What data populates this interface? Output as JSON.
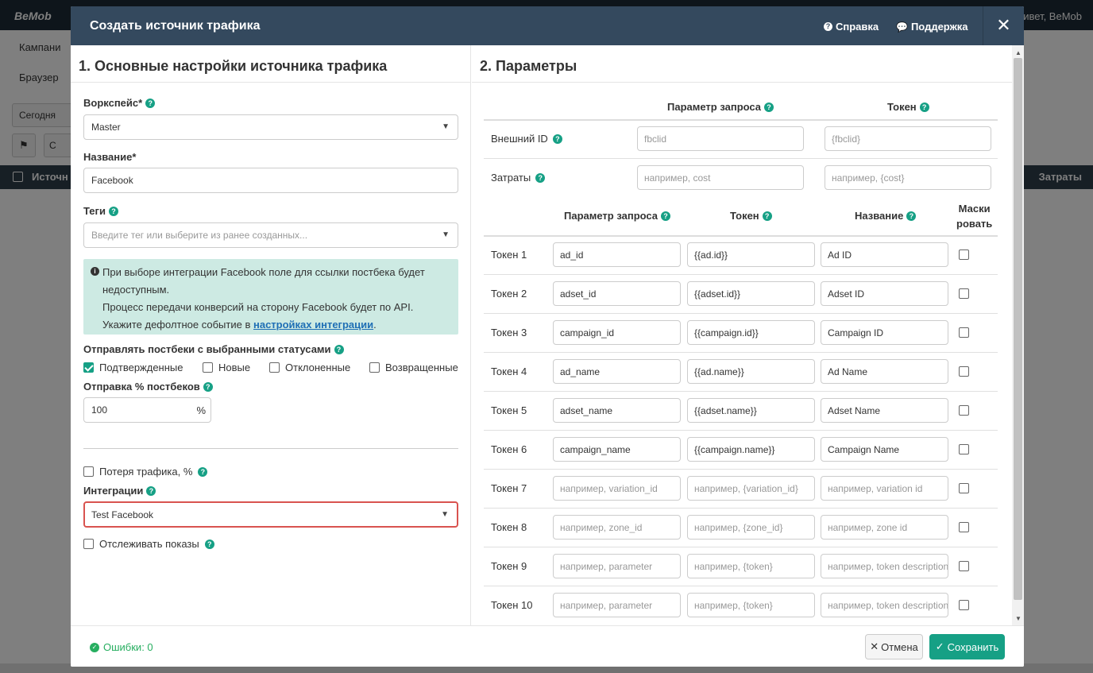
{
  "background": {
    "logo": "BeMob",
    "greeting": "ривет, BeMob",
    "nav_campaigns": "Кампани",
    "nav_browsers": "Браузер",
    "date_button": "Сегодня",
    "small_button": "С",
    "table_col_source": "Источн",
    "table_col_costs": "Затраты"
  },
  "modal": {
    "title": "Создать источник трафика",
    "help_label": "Справка",
    "support_label": "Поддержка",
    "close_label": "✕"
  },
  "left": {
    "title": "1. Основные настройки источника трафика",
    "workspace_label": "Воркспейс*",
    "workspace_value": "Master",
    "name_label": "Название*",
    "name_value": "Facebook",
    "tags_label": "Теги",
    "tags_placeholder": "Введите тег или выберите из ранее созданных...",
    "info_line1": "При выборе интеграции Facebook поле для ссылки постбека будет недоступным.",
    "info_line2": "Процесс передачи конверсий на сторону Facebook будет по API.",
    "info_line3_prefix": "Укажите дефолтное событие в ",
    "info_link": "настройках интеграции",
    "info_line3_suffix": ".",
    "statuses_label": "Отправлять постбеки с выбранными статусами",
    "statuses": [
      {
        "label": "Подтвержденные",
        "checked": true
      },
      {
        "label": "Новые",
        "checked": false
      },
      {
        "label": "Отклоненные",
        "checked": false
      },
      {
        "label": "Возвращенные",
        "checked": false
      }
    ],
    "postback_pct_label": "Отправка % постбеков",
    "postback_pct_value": "100",
    "pct_sign": "%",
    "traffic_loss_label": "Потеря трафика, %",
    "integrations_label": "Интеграции",
    "integrations_value": "Test Facebook",
    "track_impressions_label": "Отслеживать показы"
  },
  "right": {
    "title": "2. Параметры",
    "top_head_param": "Параметр запроса",
    "top_head_token": "Токен",
    "external_id_label": "Внешний ID",
    "external_id_param_placeholder": "fbclid",
    "external_id_token_placeholder": "{fbclid}",
    "costs_label": "Затраты",
    "costs_param_placeholder": "например, cost",
    "costs_token_placeholder": "например, {cost}",
    "head_param": "Параметр запроса",
    "head_token": "Токен",
    "head_name": "Название",
    "head_mask_1": "Маски",
    "head_mask_2": "ровать",
    "tokens": [
      {
        "label": "Токен 1",
        "param": "ad_id",
        "token": "{{ad.id}}",
        "name": "Ad ID",
        "p_ph": "",
        "t_ph": "",
        "n_ph": ""
      },
      {
        "label": "Токен 2",
        "param": "adset_id",
        "token": "{{adset.id}}",
        "name": "Adset ID",
        "p_ph": "",
        "t_ph": "",
        "n_ph": ""
      },
      {
        "label": "Токен 3",
        "param": "campaign_id",
        "token": "{{campaign.id}}",
        "name": "Campaign ID",
        "p_ph": "",
        "t_ph": "",
        "n_ph": ""
      },
      {
        "label": "Токен 4",
        "param": "ad_name",
        "token": "{{ad.name}}",
        "name": "Ad Name",
        "p_ph": "",
        "t_ph": "",
        "n_ph": ""
      },
      {
        "label": "Токен 5",
        "param": "adset_name",
        "token": "{{adset.name}}",
        "name": "Adset Name",
        "p_ph": "",
        "t_ph": "",
        "n_ph": ""
      },
      {
        "label": "Токен 6",
        "param": "campaign_name",
        "token": "{{campaign.name}}",
        "name": "Campaign Name",
        "p_ph": "",
        "t_ph": "",
        "n_ph": ""
      },
      {
        "label": "Токен 7",
        "param": "",
        "token": "",
        "name": "",
        "p_ph": "например, variation_id",
        "t_ph": "например, {variation_id}",
        "n_ph": "например, variation id"
      },
      {
        "label": "Токен 8",
        "param": "",
        "token": "",
        "name": "",
        "p_ph": "например, zone_id",
        "t_ph": "например, {zone_id}",
        "n_ph": "например, zone id"
      },
      {
        "label": "Токен 9",
        "param": "",
        "token": "",
        "name": "",
        "p_ph": "например, parameter",
        "t_ph": "например, {token}",
        "n_ph": "например, token description"
      },
      {
        "label": "Токен 10",
        "param": "",
        "token": "",
        "name": "",
        "p_ph": "например, parameter",
        "t_ph": "например, {token}",
        "n_ph": "например, token description"
      }
    ]
  },
  "footer": {
    "errors_label": "Ошибки: 0",
    "cancel_label": "Отмена",
    "save_label": "Сохранить"
  }
}
